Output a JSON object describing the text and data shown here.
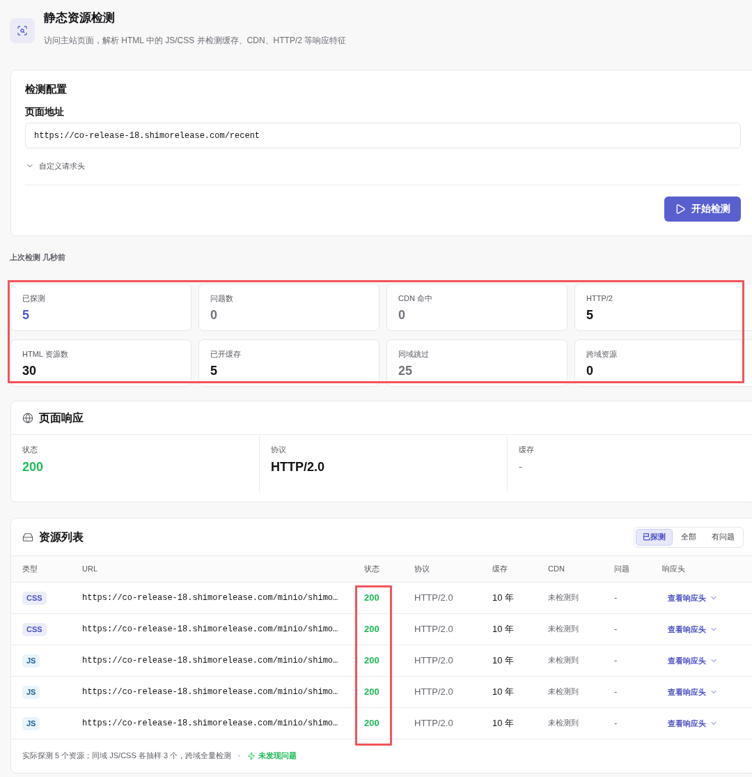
{
  "header": {
    "title": "静态资源检测",
    "subtitle": "访问主站页面，解析 HTML 中的 JS/CSS 并检测缓存、CDN、HTTP/2 等响应特征"
  },
  "config": {
    "title": "检测配置",
    "url_label": "页面地址",
    "url_value": "https://co-release-18.shimorelease.com/recent",
    "custom_headers_label": "自定义请求头",
    "start_button": "开始检测"
  },
  "last_run": "上次检测 几秒前",
  "stats": {
    "highlighted": true,
    "items": [
      {
        "label": "已探测",
        "value": "5",
        "color": "#5157d0"
      },
      {
        "label": "问题数",
        "value": "0",
        "color": "#72727a"
      },
      {
        "label": "CDN 命中",
        "value": "0",
        "color": "#72727a"
      },
      {
        "label": "HTTP/2",
        "value": "5",
        "color": "#111114"
      },
      {
        "label": "HTML 资源数",
        "value": "30",
        "color": "#111114"
      },
      {
        "label": "已开缓存",
        "value": "5",
        "color": "#111114"
      },
      {
        "label": "同域跳过",
        "value": "25",
        "color": "#72727a"
      },
      {
        "label": "跨域资源",
        "value": "0",
        "color": "#111114"
      }
    ]
  },
  "page_response": {
    "title": "页面响应",
    "fields": [
      {
        "kind": "number",
        "label": "状态",
        "value": "200",
        "color": "#1fba57"
      },
      {
        "kind": "number",
        "label": "协议",
        "value": "HTTP/2.0",
        "color": "#111114"
      },
      {
        "kind": "empty",
        "label": "缓存",
        "value": "-",
        "color": "#77777f"
      }
    ]
  },
  "resources": {
    "title": "资源列表",
    "filters": [
      {
        "label": "已探测",
        "selected": true
      },
      {
        "label": "全部",
        "selected": false
      },
      {
        "label": "有问题",
        "selected": false
      }
    ],
    "columns": [
      {
        "label": "类型",
        "highlighted": false
      },
      {
        "label": "URL",
        "highlighted": false
      },
      {
        "label": "状态",
        "highlighted": true
      },
      {
        "label": "协议",
        "highlighted": false
      },
      {
        "label": "缓存",
        "highlighted": false
      },
      {
        "label": "CDN",
        "highlighted": false
      },
      {
        "label": "问题",
        "highlighted": false
      },
      {
        "label": "响应头",
        "highlighted": false
      }
    ],
    "rows": [
      {
        "kind": "css",
        "type": "CSS",
        "url": "https://co-release-18.shimorelease.com/minio/shimo…",
        "status": "200",
        "protocol": "HTTP/2.0",
        "cache": "10 年",
        "cdn": "未检测到",
        "issue": "-",
        "headers_link": "查看响应头"
      },
      {
        "kind": "css",
        "type": "CSS",
        "url": "https://co-release-18.shimorelease.com/minio/shimo…",
        "status": "200",
        "protocol": "HTTP/2.0",
        "cache": "10 年",
        "cdn": "未检测到",
        "issue": "-",
        "headers_link": "查看响应头"
      },
      {
        "kind": "js",
        "type": "JS",
        "url": "https://co-release-18.shimorelease.com/minio/shimo…",
        "status": "200",
        "protocol": "HTTP/2.0",
        "cache": "10 年",
        "cdn": "未检测到",
        "issue": "-",
        "headers_link": "查看响应头"
      },
      {
        "kind": "js",
        "type": "JS",
        "url": "https://co-release-18.shimorelease.com/minio/shimo…",
        "status": "200",
        "protocol": "HTTP/2.0",
        "cache": "10 年",
        "cdn": "未检测到",
        "issue": "-",
        "headers_link": "查看响应头"
      },
      {
        "kind": "js",
        "type": "JS",
        "url": "https://co-release-18.shimorelease.com/minio/shimo…",
        "status": "200",
        "protocol": "HTTP/2.0",
        "cache": "10 年",
        "cdn": "未检测到",
        "issue": "-",
        "headers_link": "查看响应头"
      }
    ],
    "footer": {
      "summary": "实际探测 5 个资源；同域 JS/CSS 各抽样 3 个，跨域全量检测",
      "result": "未发现问题"
    }
  }
}
